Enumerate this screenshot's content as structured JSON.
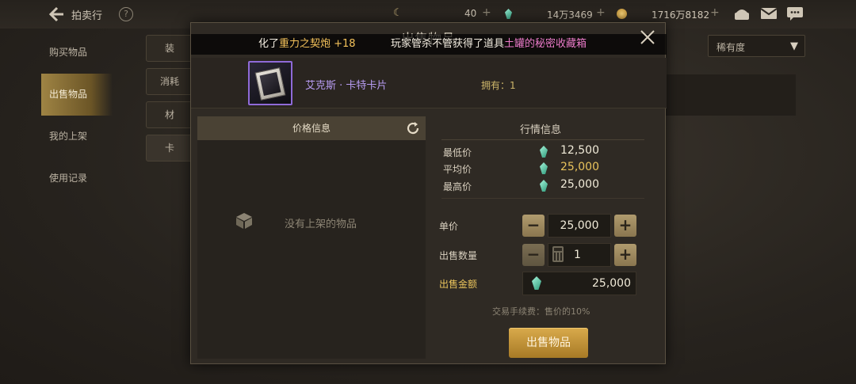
{
  "topbar": {
    "title": "拍卖行",
    "help": "?",
    "currency_1": "40",
    "currency_2": "14万3469",
    "currency_3": "1716万8182",
    "plus": "+"
  },
  "sidebar": {
    "items": [
      {
        "label": "购买物品"
      },
      {
        "label": "出售物品"
      },
      {
        "label": "我的上架"
      },
      {
        "label": "使用记录"
      }
    ]
  },
  "bg_category_buttons": [
    "装",
    "消耗",
    "材",
    "卡"
  ],
  "rarity_dropdown": {
    "label": "稀有度"
  },
  "modal": {
    "title": "出售物品",
    "ticker": {
      "seg1_pre": "化了",
      "seg1_item": "重力之契炮 +18",
      "seg2_pre": "玩家管杀不管获得了道具",
      "seg2_item": "土罐的秘密收藏箱"
    },
    "item": {
      "name": "艾克斯 · 卡特卡片",
      "owned": "拥有：1"
    },
    "price_info": {
      "header": "价格信息",
      "empty_text": "没有上架的物品"
    },
    "market": {
      "title": "行情信息",
      "rows": [
        {
          "label": "最低价",
          "value": "12,500"
        },
        {
          "label": "平均价",
          "value": "25,000"
        },
        {
          "label": "最高价",
          "value": "25,000"
        }
      ]
    },
    "form": {
      "unit_price_label": "单价",
      "unit_price": "25,000",
      "quantity_label": "出售数量",
      "quantity": "1",
      "total_label": "出售金额",
      "total": "25,000",
      "minus": "−",
      "plus": "+",
      "fee_text": "交易手续费：售价的10%",
      "sell_button": "出售物品"
    }
  },
  "colors": {
    "accent_gold": "#e9c35c",
    "item_purple": "#b69bf0",
    "ticker_pink": "#e97ac8",
    "gem_green": "#2c9a7a"
  }
}
